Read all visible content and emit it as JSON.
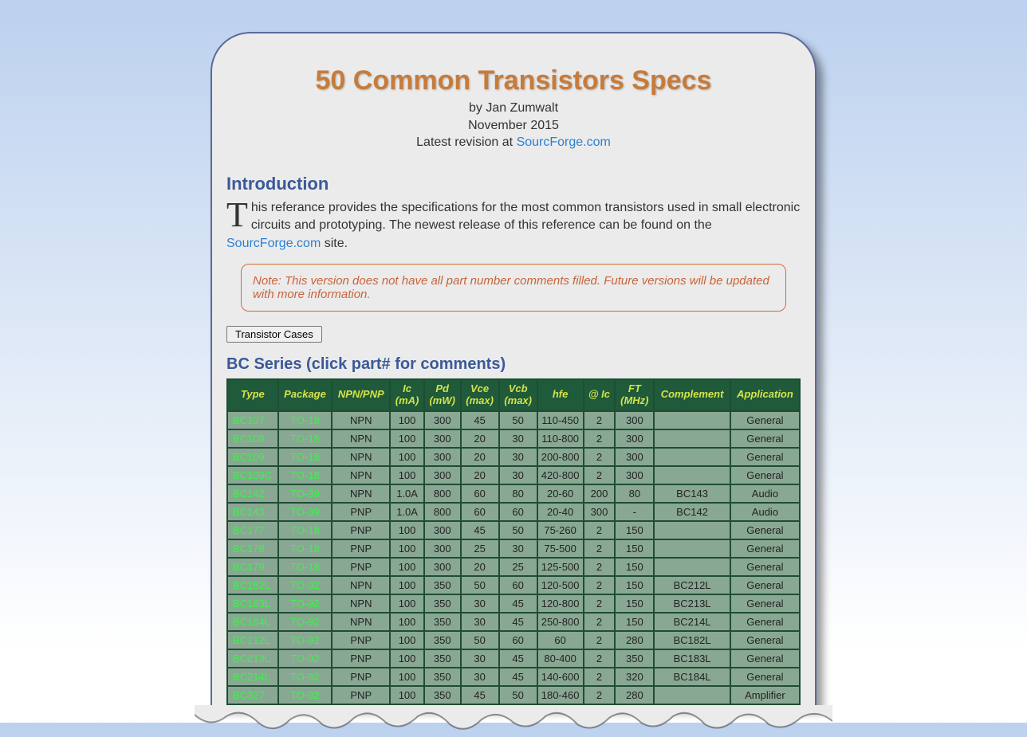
{
  "header": {
    "title": "50 Common Transistors Specs",
    "author_line": "by Jan Zumwalt",
    "date_line": "November 2015",
    "revision_prefix": "Latest revision at ",
    "revision_link_text": "SourcForge.com"
  },
  "intro": {
    "heading": "Introduction",
    "dropcap": "T",
    "paragraph_part1": "his referance provides the specifications for the most common transistors used in small electronic circuits and prototyping. The newest release of this reference can be found on the ",
    "link_text": "SourcForge.com",
    "paragraph_part2": " site."
  },
  "note": {
    "text": "Note: This version does not have all part number comments filled. Future versions will be updated with more information."
  },
  "buttons": {
    "transistor_cases": "Transistor Cases"
  },
  "table": {
    "title": "BC Series    (click part# for comments)",
    "headers": [
      "Type",
      "Package",
      "NPN/PNP",
      "Ic (mA)",
      "Pd (mW)",
      "Vce (max)",
      "Vcb (max)",
      "hfe",
      "@ Ic",
      "FT (MHz)",
      "Complement",
      "Application"
    ],
    "rows": [
      [
        "BC107",
        "TO-18",
        "NPN",
        "100",
        "300",
        "45",
        "50",
        "110-450",
        "2",
        "300",
        "",
        "General"
      ],
      [
        "BC108",
        "TO-18",
        "NPN",
        "100",
        "300",
        "20",
        "30",
        "110-800",
        "2",
        "300",
        "",
        "General"
      ],
      [
        "BC109",
        "TO-18",
        "NPN",
        "100",
        "300",
        "20",
        "30",
        "200-800",
        "2",
        "300",
        "",
        "General"
      ],
      [
        "BC109C",
        "TO-18",
        "NPN",
        "100",
        "300",
        "20",
        "30",
        "420-800",
        "2",
        "300",
        "",
        "General"
      ],
      [
        "BC142",
        "TO-39",
        "NPN",
        "1.0A",
        "800",
        "60",
        "80",
        "20-60",
        "200",
        "80",
        "BC143",
        "Audio"
      ],
      [
        "BC143",
        "TO-39",
        "PNP",
        "1.0A",
        "800",
        "60",
        "60",
        "20-40",
        "300",
        "-",
        "BC142",
        "Audio"
      ],
      [
        "BC177",
        "TO-18",
        "PNP",
        "100",
        "300",
        "45",
        "50",
        "75-260",
        "2",
        "150",
        "",
        "General"
      ],
      [
        "BC178",
        "TO-18",
        "PNP",
        "100",
        "300",
        "25",
        "30",
        "75-500",
        "2",
        "150",
        "",
        "General"
      ],
      [
        "BC179",
        "TO-18",
        "PNP",
        "100",
        "300",
        "20",
        "25",
        "125-500",
        "2",
        "150",
        "",
        "General"
      ],
      [
        "BC182L",
        "TO-92",
        "NPN",
        "100",
        "350",
        "50",
        "60",
        "120-500",
        "2",
        "150",
        "BC212L",
        "General"
      ],
      [
        "BC183L",
        "TO-92",
        "NPN",
        "100",
        "350",
        "30",
        "45",
        "120-800",
        "2",
        "150",
        "BC213L",
        "General"
      ],
      [
        "BC184L",
        "TO-92",
        "NPN",
        "100",
        "350",
        "30",
        "45",
        "250-800",
        "2",
        "150",
        "BC214L",
        "General"
      ],
      [
        "BC212L",
        "TO-92",
        "PNP",
        "100",
        "350",
        "50",
        "60",
        "60",
        "2",
        "280",
        "BC182L",
        "General"
      ],
      [
        "BC213L",
        "TO-92",
        "PNP",
        "100",
        "350",
        "30",
        "45",
        "80-400",
        "2",
        "350",
        "BC183L",
        "General"
      ],
      [
        "BC214L",
        "TO-92",
        "PNP",
        "100",
        "350",
        "30",
        "45",
        "140-600",
        "2",
        "320",
        "BC184L",
        "General"
      ],
      [
        "BC327",
        "TO-92",
        "PNP",
        "100",
        "350",
        "45",
        "50",
        "180-460",
        "2",
        "280",
        "",
        "Amplifier"
      ]
    ]
  },
  "chart_data": {
    "type": "table",
    "title": "BC Series Transistor Specifications",
    "columns": [
      "Type",
      "Package",
      "NPN/PNP",
      "Ic (mA)",
      "Pd (mW)",
      "Vce (max)",
      "Vcb (max)",
      "hfe",
      "@ Ic",
      "FT (MHz)",
      "Complement",
      "Application"
    ],
    "rows": [
      [
        "BC107",
        "TO-18",
        "NPN",
        100,
        300,
        45,
        50,
        "110-450",
        2,
        300,
        "",
        "General"
      ],
      [
        "BC108",
        "TO-18",
        "NPN",
        100,
        300,
        20,
        30,
        "110-800",
        2,
        300,
        "",
        "General"
      ],
      [
        "BC109",
        "TO-18",
        "NPN",
        100,
        300,
        20,
        30,
        "200-800",
        2,
        300,
        "",
        "General"
      ],
      [
        "BC109C",
        "TO-18",
        "NPN",
        100,
        300,
        20,
        30,
        "420-800",
        2,
        300,
        "",
        "General"
      ],
      [
        "BC142",
        "TO-39",
        "NPN",
        "1.0A",
        800,
        60,
        80,
        "20-60",
        200,
        80,
        "BC143",
        "Audio"
      ],
      [
        "BC143",
        "TO-39",
        "PNP",
        "1.0A",
        800,
        60,
        60,
        "20-40",
        300,
        "-",
        "BC142",
        "Audio"
      ],
      [
        "BC177",
        "TO-18",
        "PNP",
        100,
        300,
        45,
        50,
        "75-260",
        2,
        150,
        "",
        "General"
      ],
      [
        "BC178",
        "TO-18",
        "PNP",
        100,
        300,
        25,
        30,
        "75-500",
        2,
        150,
        "",
        "General"
      ],
      [
        "BC179",
        "TO-18",
        "PNP",
        100,
        300,
        20,
        25,
        "125-500",
        2,
        150,
        "",
        "General"
      ],
      [
        "BC182L",
        "TO-92",
        "NPN",
        100,
        350,
        50,
        60,
        "120-500",
        2,
        150,
        "BC212L",
        "General"
      ],
      [
        "BC183L",
        "TO-92",
        "NPN",
        100,
        350,
        30,
        45,
        "120-800",
        2,
        150,
        "BC213L",
        "General"
      ],
      [
        "BC184L",
        "TO-92",
        "NPN",
        100,
        350,
        30,
        45,
        "250-800",
        2,
        150,
        "BC214L",
        "General"
      ],
      [
        "BC212L",
        "TO-92",
        "PNP",
        100,
        350,
        50,
        60,
        "60",
        2,
        280,
        "BC182L",
        "General"
      ],
      [
        "BC213L",
        "TO-92",
        "PNP",
        100,
        350,
        30,
        45,
        "80-400",
        2,
        350,
        "BC183L",
        "General"
      ],
      [
        "BC214L",
        "TO-92",
        "PNP",
        100,
        350,
        30,
        45,
        "140-600",
        2,
        320,
        "BC184L",
        "General"
      ],
      [
        "BC327",
        "TO-92",
        "PNP",
        100,
        350,
        45,
        50,
        "180-460",
        2,
        280,
        "",
        "Amplifier"
      ]
    ]
  }
}
